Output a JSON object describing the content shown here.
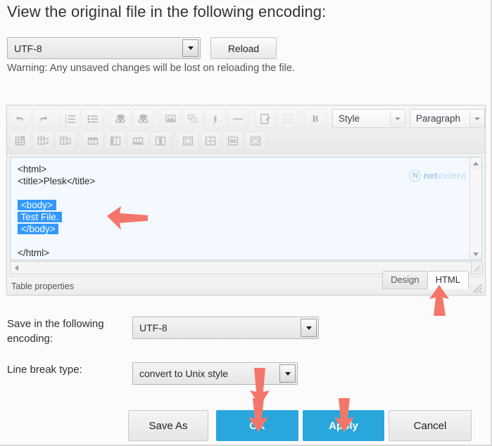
{
  "page": {
    "title": "View the original file in the following encoding:",
    "warning": "Warning: Any unsaved changes will be lost on reloading the file."
  },
  "view_encoding": {
    "label": "View the original file in the following encoding:",
    "value": "UTF-8",
    "reload_label": "Reload"
  },
  "editor": {
    "toolbar": {
      "row1_icons": [
        "undo-icon",
        "redo-icon",
        "numbered-list-icon",
        "bullet-list-icon",
        "insert-link-icon",
        "unlink-icon",
        "insert-image-icon",
        "insert-media-icon",
        "insert-flash-icon",
        "horizontal-rule-icon",
        "edit-source-icon",
        "show-guidelines-icon",
        "bold-icon"
      ],
      "style_select": "Style",
      "paragraph_select": "Paragraph",
      "row2_icons": [
        "insert-table-icon",
        "table-row-properties-icon",
        "table-cell-properties-icon",
        "insert-row-before-icon",
        "insert-column-before-icon",
        "insert-row-after-icon",
        "insert-column-after-icon",
        "delete-row-icon",
        "delete-column-icon",
        "merge-cells-icon",
        "split-cell-icon"
      ]
    },
    "code_lines": [
      {
        "text": "<html>",
        "highlighted": false
      },
      {
        "text": "<title>Plesk</title>",
        "highlighted": false
      },
      {
        "text": "",
        "highlighted": false
      },
      {
        "text": "<body>",
        "highlighted": true
      },
      {
        "text": "Test File.",
        "highlighted": true
      },
      {
        "text": "</body>",
        "highlighted": true
      },
      {
        "text": "",
        "highlighted": false
      },
      {
        "text": "</html>",
        "highlighted": false
      }
    ],
    "watermark": {
      "mark": "N",
      "bold_part": "net",
      "light_part": "cetera"
    },
    "status_text": "Table properties",
    "tabs": [
      {
        "label": "Design",
        "active": false
      },
      {
        "label": "HTML",
        "active": true
      }
    ]
  },
  "save_encoding": {
    "label": "Save in the following encoding:",
    "value": "UTF-8"
  },
  "line_break": {
    "label": "Line break type:",
    "value": "convert to Unix style"
  },
  "footer": {
    "save_as": "Save As",
    "ok": "OK",
    "apply": "Apply",
    "cancel": "Cancel"
  },
  "annotations": {
    "arrow_color": "#F4766A",
    "arrows": [
      {
        "name": "arrow-to-selected-code",
        "direction": "left"
      },
      {
        "name": "arrow-to-html-tab",
        "direction": "up"
      },
      {
        "name": "arrow-to-line-break-select",
        "direction": "down"
      },
      {
        "name": "arrow-to-ok-button",
        "direction": "down"
      },
      {
        "name": "arrow-to-apply-button",
        "direction": "down"
      }
    ]
  },
  "colors": {
    "accent_blue": "#29a7dc",
    "selection_blue": "#3399ff",
    "code_background": "#f3f9ff",
    "arrow_red": "#F4766A"
  }
}
